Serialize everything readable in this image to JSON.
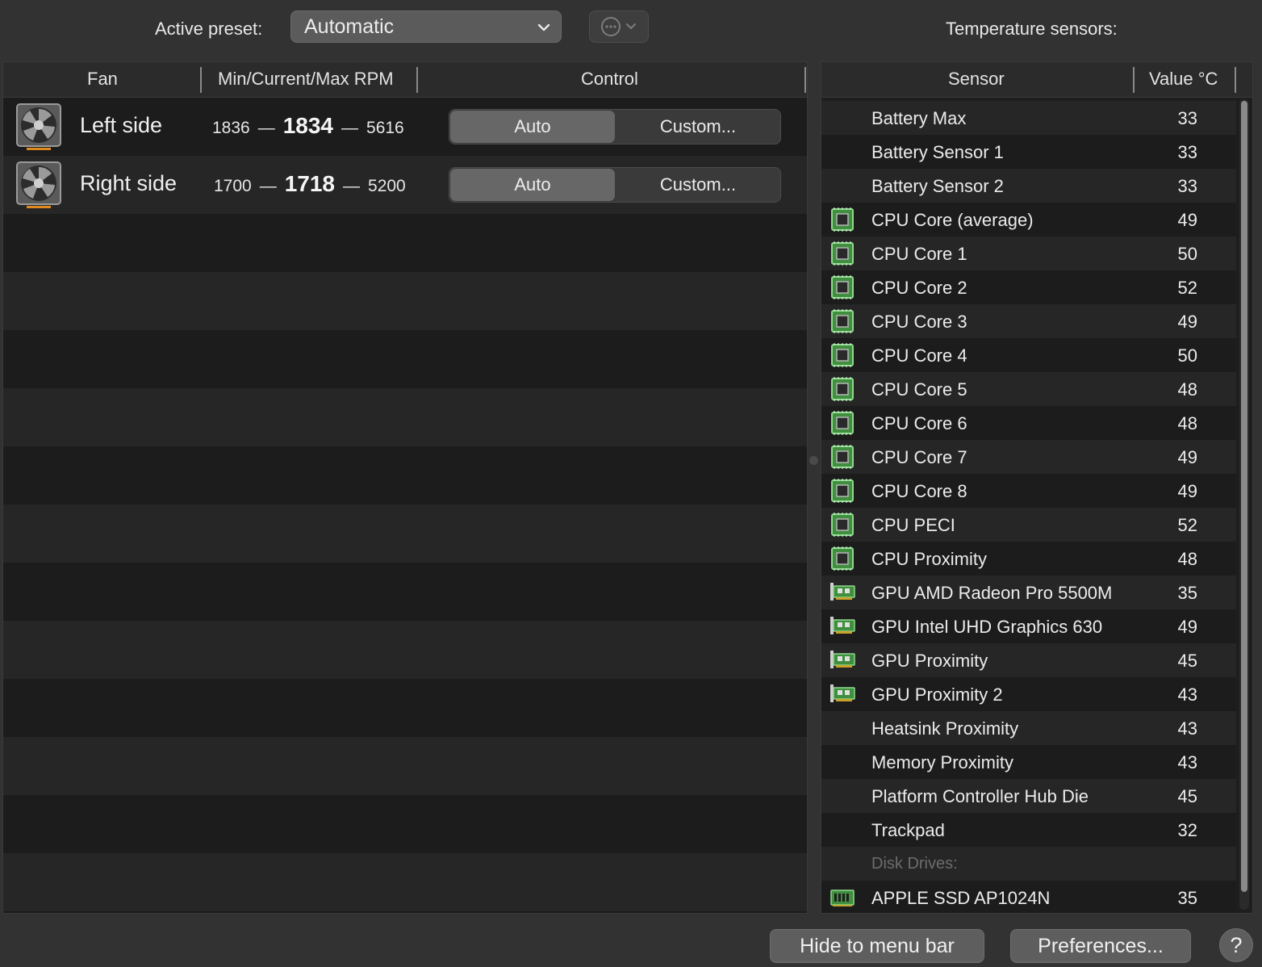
{
  "toolbar": {
    "preset_label": "Active preset:",
    "preset_value": "Automatic",
    "sensors_title": "Temperature sensors:"
  },
  "fan_table": {
    "columns": [
      "Fan",
      "Min/Current/Max RPM",
      "Control"
    ],
    "rows": [
      {
        "name": "Left side",
        "min": "1836",
        "current": "1834",
        "max": "5616",
        "dash": "—",
        "control": [
          "Auto",
          "Custom..."
        ],
        "selected": "Auto"
      },
      {
        "name": "Right side",
        "min": "1700",
        "current": "1718",
        "max": "5200",
        "dash": "—",
        "control": [
          "Auto",
          "Custom..."
        ],
        "selected": "Auto"
      }
    ]
  },
  "sensor_table": {
    "columns": [
      "Sensor",
      "Value °C"
    ],
    "rows": [
      {
        "name": "Battery Max",
        "value": "33",
        "icon": "none"
      },
      {
        "name": "Battery Sensor 1",
        "value": "33",
        "icon": "none"
      },
      {
        "name": "Battery Sensor 2",
        "value": "33",
        "icon": "none"
      },
      {
        "name": "CPU Core (average)",
        "value": "49",
        "icon": "cpu-chip-icon"
      },
      {
        "name": "CPU Core 1",
        "value": "50",
        "icon": "cpu-chip-icon"
      },
      {
        "name": "CPU Core 2",
        "value": "52",
        "icon": "cpu-chip-icon"
      },
      {
        "name": "CPU Core 3",
        "value": "49",
        "icon": "cpu-chip-icon"
      },
      {
        "name": "CPU Core 4",
        "value": "50",
        "icon": "cpu-chip-icon"
      },
      {
        "name": "CPU Core 5",
        "value": "48",
        "icon": "cpu-chip-icon"
      },
      {
        "name": "CPU Core 6",
        "value": "48",
        "icon": "cpu-chip-icon"
      },
      {
        "name": "CPU Core 7",
        "value": "49",
        "icon": "cpu-chip-icon"
      },
      {
        "name": "CPU Core 8",
        "value": "49",
        "icon": "cpu-chip-icon"
      },
      {
        "name": "CPU PECI",
        "value": "52",
        "icon": "cpu-chip-icon"
      },
      {
        "name": "CPU Proximity",
        "value": "48",
        "icon": "cpu-chip-icon"
      },
      {
        "name": "GPU AMD Radeon Pro 5500M",
        "value": "35",
        "icon": "gpu-card-icon"
      },
      {
        "name": "GPU Intel UHD Graphics 630",
        "value": "49",
        "icon": "gpu-card-icon"
      },
      {
        "name": "GPU Proximity",
        "value": "45",
        "icon": "gpu-card-icon"
      },
      {
        "name": "GPU Proximity 2",
        "value": "43",
        "icon": "gpu-card-icon"
      },
      {
        "name": "Heatsink Proximity",
        "value": "43",
        "icon": "none"
      },
      {
        "name": "Memory Proximity",
        "value": "43",
        "icon": "none"
      },
      {
        "name": "Platform Controller Hub Die",
        "value": "45",
        "icon": "none"
      },
      {
        "name": "Trackpad",
        "value": "32",
        "icon": "none"
      },
      {
        "name": "Disk Drives:",
        "value": "",
        "icon": "none",
        "group": true
      },
      {
        "name": "APPLE SSD AP1024N",
        "value": "35",
        "icon": "ssd-icon"
      }
    ]
  },
  "footer": {
    "hide_label": "Hide to menu bar",
    "prefs_label": "Preferences...",
    "help_label": "?"
  },
  "colors": {
    "background": "#323232",
    "chip_green": "#4caf50",
    "selected_segment": "#676767"
  }
}
